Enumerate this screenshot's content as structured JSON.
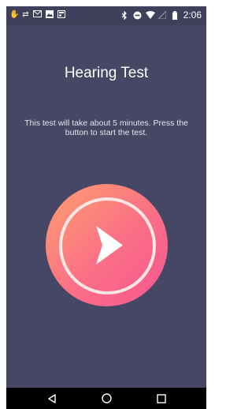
{
  "status_bar": {
    "left_icons": [
      "hand-icon",
      "sync-icon",
      "gmail-icon",
      "image-icon",
      "news-icon"
    ],
    "right_icons": [
      "bluetooth-icon",
      "do-not-disturb-icon",
      "wifi-icon",
      "signal-icon",
      "battery-icon"
    ],
    "time": "2:06"
  },
  "main": {
    "title": "Hearing Test",
    "description": "This test will take about 5 minutes. Press the button to start the test.",
    "start_button_icon": "play-icon"
  },
  "colors": {
    "background": "#464764",
    "button_gradient_start": "#fd9f6f",
    "button_gradient_end": "#f5558f"
  },
  "nav_bar": {
    "buttons": [
      "back-icon",
      "home-icon",
      "recents-icon"
    ]
  }
}
